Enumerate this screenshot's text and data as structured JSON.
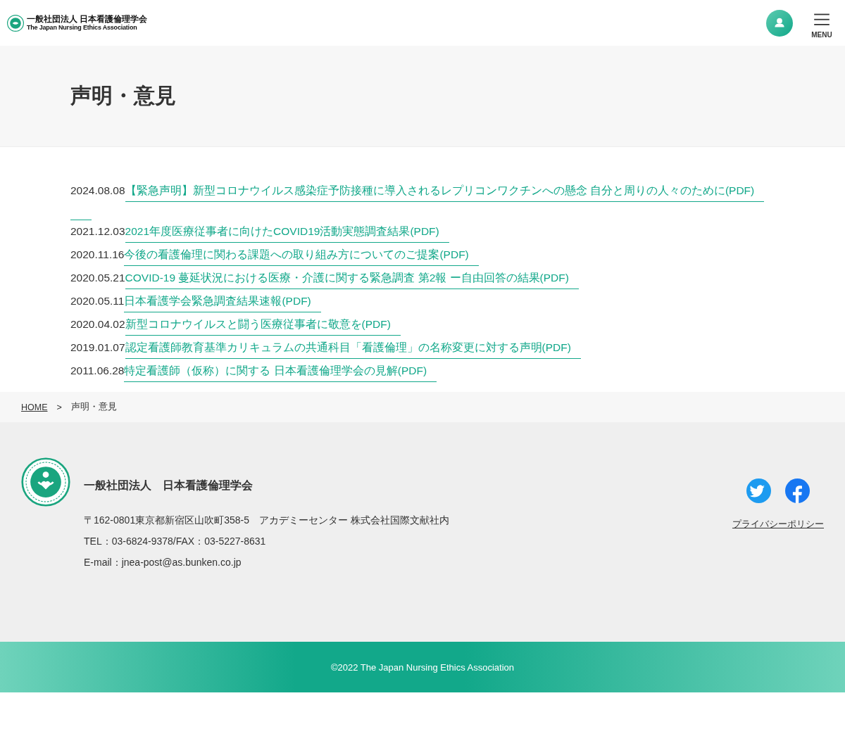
{
  "header": {
    "logo_line_1": "一般社団法人 日本看護倫理学会",
    "logo_line_2": "The Japan Nursing Ethics Association",
    "menu_label": "MENU"
  },
  "page_title": "声明・意見",
  "statements": [
    {
      "date": "2024.08.08",
      "title": "【緊急声明】新型コロナウイルス感染症予防接種に導入されるレプリコンワクチンへの懸念 自分と周りの人々のために(PDF)",
      "spacer_after": true
    },
    {
      "date": "2021.12.03",
      "title": "2021年度医療従事者に向けたCOVID19活動実態調査結果(PDF)",
      "spacer_after": false
    },
    {
      "date": "2020.11.16",
      "title": "今後の看護倫理に関わる課題への取り組み方についてのご提案(PDF)",
      "spacer_after": false
    },
    {
      "date": "2020.05.21",
      "title": "COVID-19 蔓延状況における医療・介護に関する緊急調査 第2報 ー自由回答の結果(PDF)",
      "spacer_after": false
    },
    {
      "date": "2020.05.11",
      "title": "日本看護学会緊急調査結果速報(PDF)",
      "spacer_after": false
    },
    {
      "date": "2020.04.02",
      "title": "新型コロナウイルスと闘う医療従事者に敬意を(PDF)",
      "spacer_after": false
    },
    {
      "date": "2019.01.07",
      "title": "認定看護師教育基準カリキュラムの共通科目「看護倫理」の名称変更に対する声明(PDF)",
      "spacer_after": false
    },
    {
      "date": "2011.06.28",
      "title": "特定看護師（仮称）に関する 日本看護倫理学会の見解(PDF)",
      "spacer_after": false
    }
  ],
  "breadcrumb": {
    "home": "HOME",
    "separator": ">",
    "current": "声明・意見"
  },
  "footer": {
    "org_name": "一般社団法人　日本看護倫理学会",
    "address": "〒162-0801東京都新宿区山吹町358-5　アカデミーセンター 株式会社国際文献社内",
    "phone": "TEL：03-6824-9378/FAX：03-5227-8631",
    "email": "E-mail：jnea-post@as.bunken.co.jp",
    "privacy_link": "プライバシーポリシー"
  },
  "copyright": "©2022 The Japan Nursing Ethics Association"
}
